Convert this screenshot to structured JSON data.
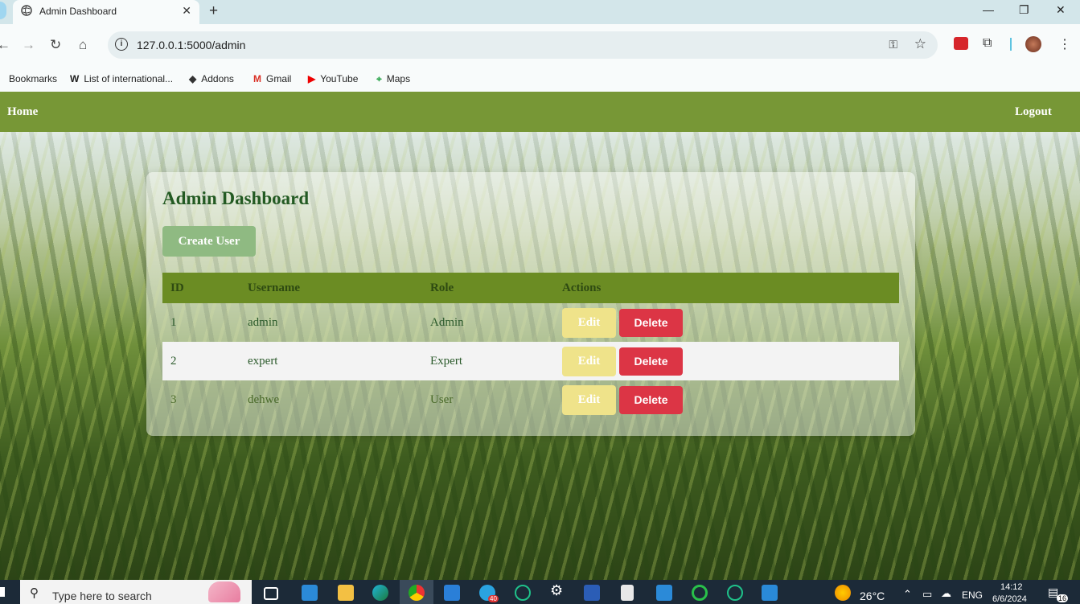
{
  "browser": {
    "tab_title": "Admin Dashboard",
    "tab_close": "✕",
    "new_tab": "+",
    "url": "127.0.0.1:5000/admin",
    "window_controls": {
      "minimize": "—",
      "restore": "❐",
      "close": "✕"
    },
    "bookmarks": [
      {
        "icon": "folder-icon",
        "label": "Bookmarks"
      },
      {
        "icon": "wikipedia-icon",
        "label": "List of international..."
      },
      {
        "icon": "addons-icon",
        "label": "Addons"
      },
      {
        "icon": "gmail-icon",
        "label": "Gmail"
      },
      {
        "icon": "youtube-icon",
        "label": "YouTube"
      },
      {
        "icon": "maps-icon",
        "label": "Maps"
      }
    ]
  },
  "navbar": {
    "home": "Home",
    "logout": "Logout",
    "color": "#779736"
  },
  "dashboard": {
    "title": "Admin Dashboard",
    "create_button": "Create User",
    "columns": [
      "ID",
      "Username",
      "Role",
      "Actions"
    ],
    "rows": [
      {
        "id": "1",
        "username": "admin",
        "role": "Admin"
      },
      {
        "id": "2",
        "username": "expert",
        "role": "Expert"
      },
      {
        "id": "3",
        "username": "dehwe",
        "role": "User"
      }
    ],
    "edit_label": "Edit",
    "delete_label": "Delete"
  },
  "taskbar": {
    "search_placeholder": "Type here to search",
    "weather": "26°C",
    "language": "ENG",
    "time": "14:12",
    "date": "6/6/2024",
    "notifications": "16",
    "telegram_badge": "40"
  }
}
